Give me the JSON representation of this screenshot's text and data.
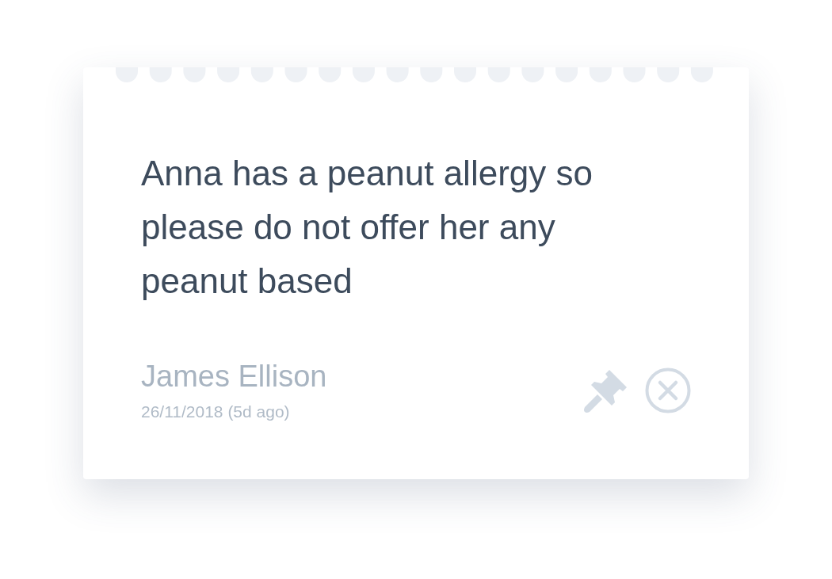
{
  "note": {
    "text": "Anna has a peanut allergy so please do not offer her any peanut based",
    "author": "James Ellison",
    "date": "26/11/2018 (5d ago)"
  }
}
